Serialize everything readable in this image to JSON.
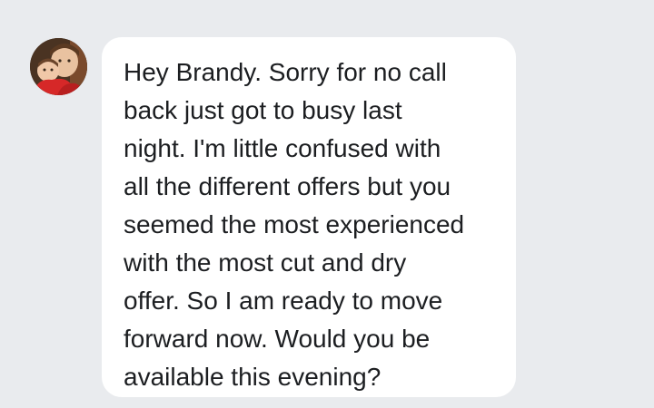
{
  "conversation": {
    "incoming_message": {
      "avatar_icon": "contact-photo-icon",
      "text": "Hey Brandy. Sorry for no call\nback just got to busy last\nnight.  I'm little confused with\nall the different offers but you\nseemed the most experienced\nwith the most cut and dry\noffer. So I am ready to move\nforward now. Would you be\navailable this evening?"
    }
  },
  "colors": {
    "background": "#e9ebee",
    "bubble": "#ffffff",
    "text": "#1c1e21"
  }
}
